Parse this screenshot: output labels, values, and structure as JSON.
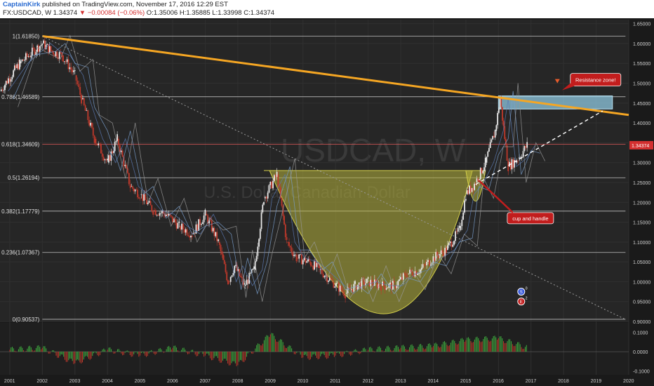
{
  "header": {
    "author": "CaptainKirk",
    "published": "published on TradingView.com, November 17, 2016 12:29 EST",
    "symbol": "FX:USDCAD, W",
    "last": "1.34374",
    "change_arrow": "▼",
    "change": "−0.00084 (−0.06%)",
    "open": "O:1.35006",
    "high": "H:1.35885",
    "low": "L:1.33998",
    "close": "C:1.34374"
  },
  "watermark": {
    "line1": "USDCAD, W",
    "line2": "U.S. Dollar/Canadian Dollar"
  },
  "colors": {
    "background": "#1a1a1a",
    "plot_bg": "#212121",
    "bull": "#e8e8e8",
    "bear": "#c0392b",
    "trendline": "#f5a623",
    "fib_line": "#bfbfbf",
    "fib_618": "#e05a5a",
    "cup_fill": "#b7b33c",
    "resistance_box": "#8fc8e0",
    "callout": "#c21d1d",
    "price_tag": "#d32f2f",
    "oscillator_up": "#3fae3f",
    "oscillator_down": "#c0392b"
  },
  "annotations": [
    {
      "text": "Resistance zone!",
      "anchor": "resistance-box"
    },
    {
      "text": "cup and handle",
      "anchor": "cup-handle"
    }
  ],
  "event_markers": [
    {
      "label": "S",
      "count": "0"
    },
    {
      "label": "E",
      "count": "2"
    }
  ],
  "chart_data": [
    {
      "type": "line",
      "title": "USDCAD, W",
      "x_axis": {
        "labels": [
          "2001",
          "2002",
          "2003",
          "2004",
          "2005",
          "2006",
          "2007",
          "2008",
          "2009",
          "2010",
          "2011",
          "2012",
          "2013",
          "2014",
          "2015",
          "2016",
          "2017",
          "2018",
          "2019",
          "2020"
        ],
        "range": [
          2000.7,
          2020.0
        ]
      },
      "y_axis": {
        "ticks": [
          "1.65000",
          "1.60000",
          "1.55000",
          "1.50000",
          "1.45000",
          "1.40000",
          "1.35000",
          "1.30000",
          "1.25000",
          "1.20000",
          "1.15000",
          "1.10000",
          "1.05000",
          "1.00000",
          "0.95000",
          "0.90000"
        ],
        "range": [
          0.9,
          1.66
        ]
      },
      "last_price_label": "1.34374",
      "last_price": 1.34374,
      "fibonacci_levels": [
        {
          "label": "1(1.61850)",
          "value": 1.6185
        },
        {
          "label": "0.786(1.46589)",
          "value": 1.46589
        },
        {
          "label": "0.618(1.34609)",
          "value": 1.34609
        },
        {
          "label": "0.5(1.26194)",
          "value": 1.26194
        },
        {
          "label": "0.382(1.17779)",
          "value": 1.17779
        },
        {
          "label": "0.236(1.07367)",
          "value": 1.07367
        },
        {
          "label": "0(0.90537)",
          "value": 0.90537
        }
      ],
      "series": [
        {
          "values_x": [
            2000.7,
            2001.3,
            2002.0,
            2002.3,
            2002.6,
            2003.0,
            2003.2,
            2003.6,
            2004.0,
            2004.3,
            2004.7,
            2005.0,
            2005.4,
            2005.8,
            2006.2,
            2006.6,
            2007.0,
            2007.4,
            2007.7,
            2007.9,
            2008.2,
            2008.5,
            2008.8,
            2009.2,
            2009.5,
            2009.8,
            2010.2,
            2010.5,
            2010.9,
            2011.3,
            2011.6,
            2012.0,
            2012.4,
            2012.8,
            2013.2,
            2013.6,
            2014.0,
            2014.4,
            2014.8,
            2015.0,
            2015.3,
            2015.6,
            2015.9,
            2016.05,
            2016.3,
            2016.6,
            2016.88
          ],
          "values_y": [
            1.48,
            1.55,
            1.6,
            1.58,
            1.57,
            1.52,
            1.46,
            1.36,
            1.3,
            1.36,
            1.24,
            1.22,
            1.18,
            1.17,
            1.14,
            1.12,
            1.17,
            1.1,
            1.0,
            1.04,
            0.99,
            1.03,
            1.21,
            1.27,
            1.1,
            1.06,
            1.05,
            1.03,
            1.0,
            0.97,
            0.99,
            1.0,
            0.99,
            0.99,
            1.02,
            1.03,
            1.06,
            1.08,
            1.13,
            1.22,
            1.25,
            1.3,
            1.38,
            1.46,
            1.29,
            1.31,
            1.34374
          ]
        }
      ],
      "trendlines": [
        {
          "x": [
            2002.0,
            2020.0
          ],
          "y": [
            1.6185,
            1.42
          ]
        },
        {
          "x": [
            2002.0,
            2019.9
          ],
          "y": [
            1.6185,
            0.905
          ]
        },
        {
          "x": [
            2015.3,
            2019.2
          ],
          "y": [
            1.245,
            1.43
          ]
        }
      ],
      "resistance_zone": {
        "x": [
          2016.0,
          2019.5
        ],
        "y": [
          1.435,
          1.468
        ]
      },
      "cup": {
        "x": [
          2008.8,
          2015.2
        ],
        "rim": 1.28,
        "bottom": 0.91
      },
      "handle": {
        "x": [
          2015.0,
          2015.6
        ],
        "rim": 1.28,
        "bottom": 1.17
      }
    },
    {
      "type": "bar",
      "title": "",
      "y_axis": {
        "ticks": [
          "0.1000",
          "0.0000",
          "-0.1000"
        ],
        "range": [
          -0.12,
          0.15
        ]
      },
      "x": [
        2001,
        2002,
        2003,
        2004,
        2005,
        2006,
        2007,
        2008,
        2009,
        2010,
        2011,
        2012,
        2013,
        2014,
        2015,
        2016,
        2016.9
      ],
      "values": [
        0.01,
        0.02,
        -0.06,
        0.01,
        -0.02,
        0.02,
        -0.02,
        -0.07,
        0.09,
        -0.03,
        -0.02,
        0.01,
        0.02,
        0.03,
        0.06,
        0.07,
        0.02
      ]
    }
  ]
}
